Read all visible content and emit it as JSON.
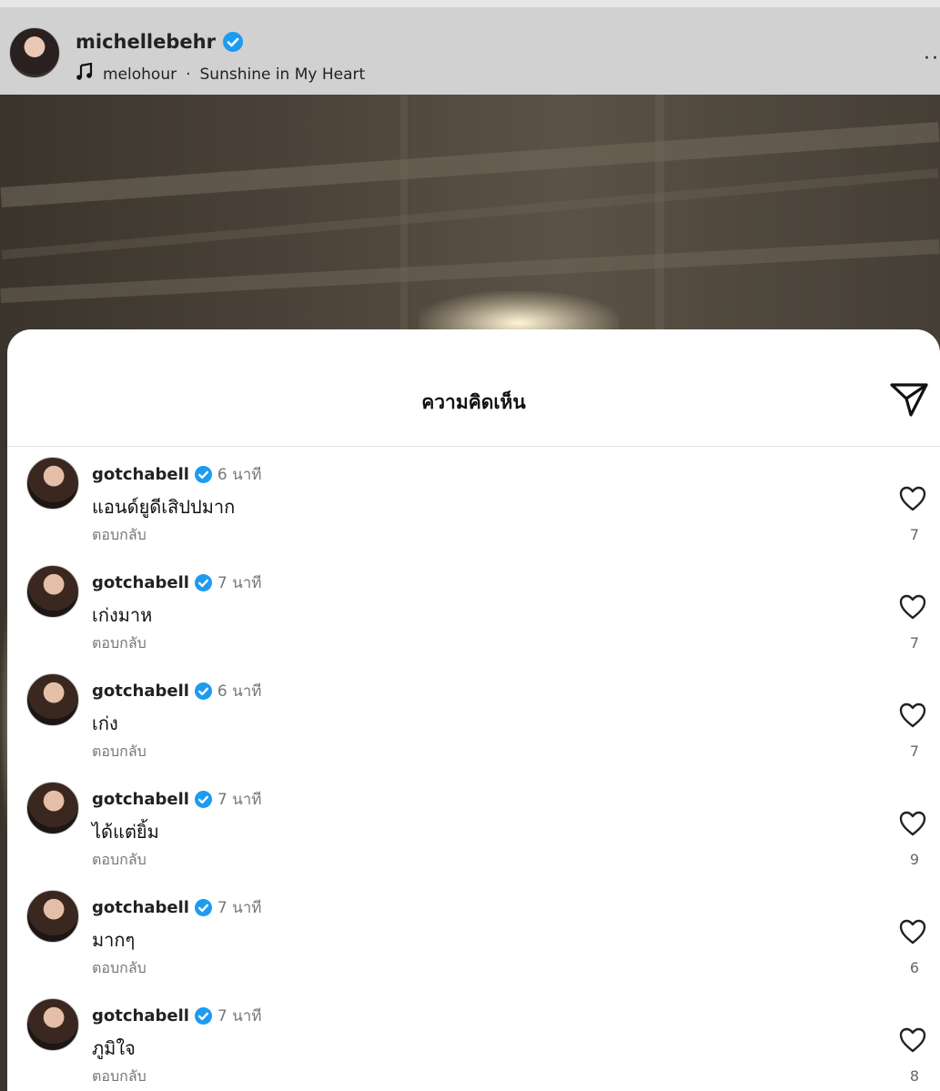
{
  "header": {
    "username": "michellebehr",
    "music_artist": "melohour",
    "music_separator": "·",
    "music_title": "Sunshine in My Heart",
    "more_label": "··"
  },
  "sheet": {
    "title": "ความคิดเห็น"
  },
  "icons": {
    "verified": "verified-badge-icon",
    "music": "music-note-icon",
    "share": "send-paper-plane-icon",
    "like": "heart-outline-icon"
  },
  "colors": {
    "verified": "#1d9bf0",
    "header_bg": "#d1d1d1",
    "sheet_bg": "#ffffff"
  },
  "comments": [
    {
      "user": "gotchabell",
      "time": "6 นาที",
      "text": "แอนด์ยูดีเสิปปมาก",
      "reply": "ตอบกลับ",
      "likes": "7"
    },
    {
      "user": "gotchabell",
      "time": "7 นาที",
      "text": "เก่งมาห",
      "reply": "ตอบกลับ",
      "likes": "7"
    },
    {
      "user": "gotchabell",
      "time": "6 นาที",
      "text": "เก่ง",
      "reply": "ตอบกลับ",
      "likes": "7"
    },
    {
      "user": "gotchabell",
      "time": "7 นาที",
      "text": "ได้แต่ยิ้ม",
      "reply": "ตอบกลับ",
      "likes": "9"
    },
    {
      "user": "gotchabell",
      "time": "7 นาที",
      "text": "มากๆ",
      "reply": "ตอบกลับ",
      "likes": "6"
    },
    {
      "user": "gotchabell",
      "time": "7 นาที",
      "text": "ภูมิใจ",
      "reply": "ตอบกลับ",
      "likes": "8"
    }
  ]
}
